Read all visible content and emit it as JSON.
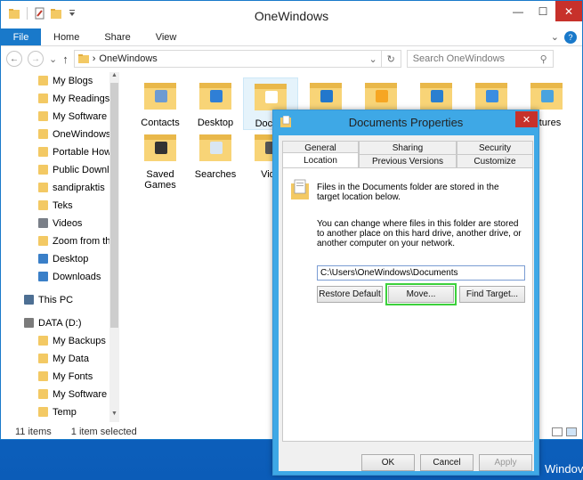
{
  "window": {
    "title": "OneWindows",
    "controls": {
      "minimize": "—",
      "maximize": "☐",
      "close": "✕"
    }
  },
  "ribbon": {
    "tabs": [
      "File",
      "Home",
      "Share",
      "View"
    ],
    "chevron": "⌄",
    "help": "?"
  },
  "address": {
    "back": "←",
    "forward": "→",
    "up": "↑",
    "separator": "›",
    "path": "OneWindows",
    "dropdown": "⌄",
    "refresh": "↻",
    "search_placeholder": "Search OneWindows",
    "search_icon": "⚲"
  },
  "nav_pane": {
    "items": [
      {
        "label": "My Blogs",
        "icon": "folder-icon",
        "color": "#f3c964"
      },
      {
        "label": "My Readings",
        "icon": "folder-icon",
        "color": "#f3c964"
      },
      {
        "label": "My Software",
        "icon": "folder-icon",
        "color": "#f3c964"
      },
      {
        "label": "OneWindows",
        "icon": "folder-icon",
        "color": "#f3c964"
      },
      {
        "label": "Portable HowT",
        "icon": "folder-icon",
        "color": "#f3c964"
      },
      {
        "label": "Public Downlo",
        "icon": "folder-icon",
        "color": "#f3c964"
      },
      {
        "label": "sandipraktis",
        "icon": "folder-icon",
        "color": "#f3c964"
      },
      {
        "label": "Teks",
        "icon": "folder-icon",
        "color": "#f3c964"
      },
      {
        "label": "Videos",
        "icon": "videos-icon",
        "color": "#7a7f88"
      },
      {
        "label": "Zoom from th",
        "icon": "folder-icon",
        "color": "#f3c964"
      },
      {
        "label": "Desktop",
        "icon": "desktop-icon",
        "color": "#3a7fc8"
      },
      {
        "label": "Downloads",
        "icon": "downloads-icon",
        "color": "#3a7fc8"
      },
      {
        "label": "This PC",
        "icon": "computer-icon",
        "color": "#4d6f93"
      },
      {
        "label": "DATA (D:)",
        "icon": "drive-icon",
        "color": "#7b7b7b"
      },
      {
        "label": "My Backups",
        "icon": "folder-icon",
        "color": "#f3c964"
      },
      {
        "label": "My Data",
        "icon": "folder-icon",
        "color": "#f3c964"
      },
      {
        "label": "My Fonts",
        "icon": "folder-icon",
        "color": "#f3c964"
      },
      {
        "label": "My Software",
        "icon": "folder-icon",
        "color": "#f3c964"
      },
      {
        "label": "Temp",
        "icon": "folder-icon",
        "color": "#f3c964"
      }
    ]
  },
  "files": [
    {
      "label": "Contacts",
      "icon": "contacts-folder-icon"
    },
    {
      "label": "Desktop",
      "icon": "desktop-folder-icon"
    },
    {
      "label": "Docum",
      "icon": "documents-folder-icon"
    },
    {
      "label": "",
      "icon": "downloads-folder-icon"
    },
    {
      "label": "",
      "icon": "favorites-folder-icon"
    },
    {
      "label": "",
      "icon": "links-folder-icon"
    },
    {
      "label": "",
      "icon": "music-folder-icon"
    },
    {
      "label": "ictures",
      "icon": "pictures-folder-icon"
    },
    {
      "label": "Saved\nGames",
      "icon": "saved-games-folder-icon"
    },
    {
      "label": "Searches",
      "icon": "searches-folder-icon"
    },
    {
      "label": "Vide",
      "icon": "videos-folder-icon"
    }
  ],
  "status": {
    "items_count": "11 items",
    "selected": "1 item selected"
  },
  "dialog": {
    "title": "Documents Properties",
    "close": "✕",
    "tabs_row1": [
      "General",
      "Sharing",
      "Security"
    ],
    "tabs_row2": [
      "Location",
      "Previous Versions",
      "Customize"
    ],
    "info1": "Files in the Documents folder are stored in the target location below.",
    "info2": "You can change where files in this folder are stored to another place on this hard drive, another drive, or another computer on your network.",
    "path_value": "C:\\Users\\OneWindows\\Documents",
    "buttons": {
      "restore_default": "Restore Default",
      "move": "Move...",
      "find_target": "Find Target..."
    },
    "footer": {
      "ok": "OK",
      "cancel": "Cancel",
      "apply": "Apply"
    }
  },
  "desktop": {
    "label": "Windov"
  },
  "colors": {
    "accent": "#1979ca",
    "dialog_frame": "#3ea8e6",
    "close_red": "#c7312b",
    "highlight_green": "#3cd13c",
    "folder_yellow": "#f3c964"
  }
}
